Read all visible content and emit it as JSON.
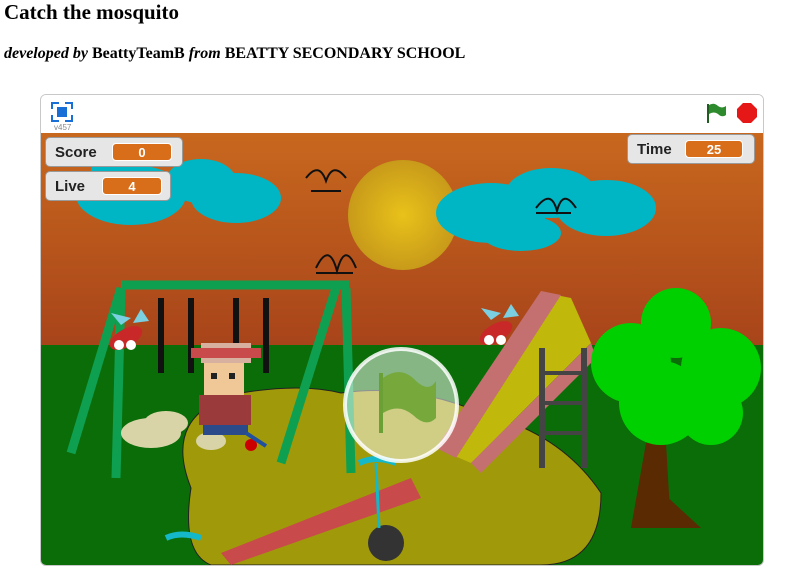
{
  "page": {
    "title": "Catch the mosquito",
    "developed_by_label": "developed by",
    "author": "BeattyTeamB",
    "from_label": "from",
    "school": "BEATTY SECONDARY SCHOOL"
  },
  "player": {
    "version": "v457",
    "fullscreen_icon": "fullscreen-icon",
    "green_flag_icon": "green-flag-icon",
    "stop_icon": "stop-sign-icon"
  },
  "monitors": {
    "score": {
      "label": "Score",
      "value": "0"
    },
    "live": {
      "label": "Live",
      "value": "4"
    },
    "time": {
      "label": "Time",
      "value": "25"
    }
  },
  "colors": {
    "monitor_value": "#d86d1a",
    "sky_top": "#c8681e",
    "sky_bottom": "#a8441a",
    "grass": "#0a6d08",
    "sun": "#e2b81a",
    "cloud": "#00b6c4",
    "stop": "#e61717",
    "flag": "#2d8a2d"
  }
}
